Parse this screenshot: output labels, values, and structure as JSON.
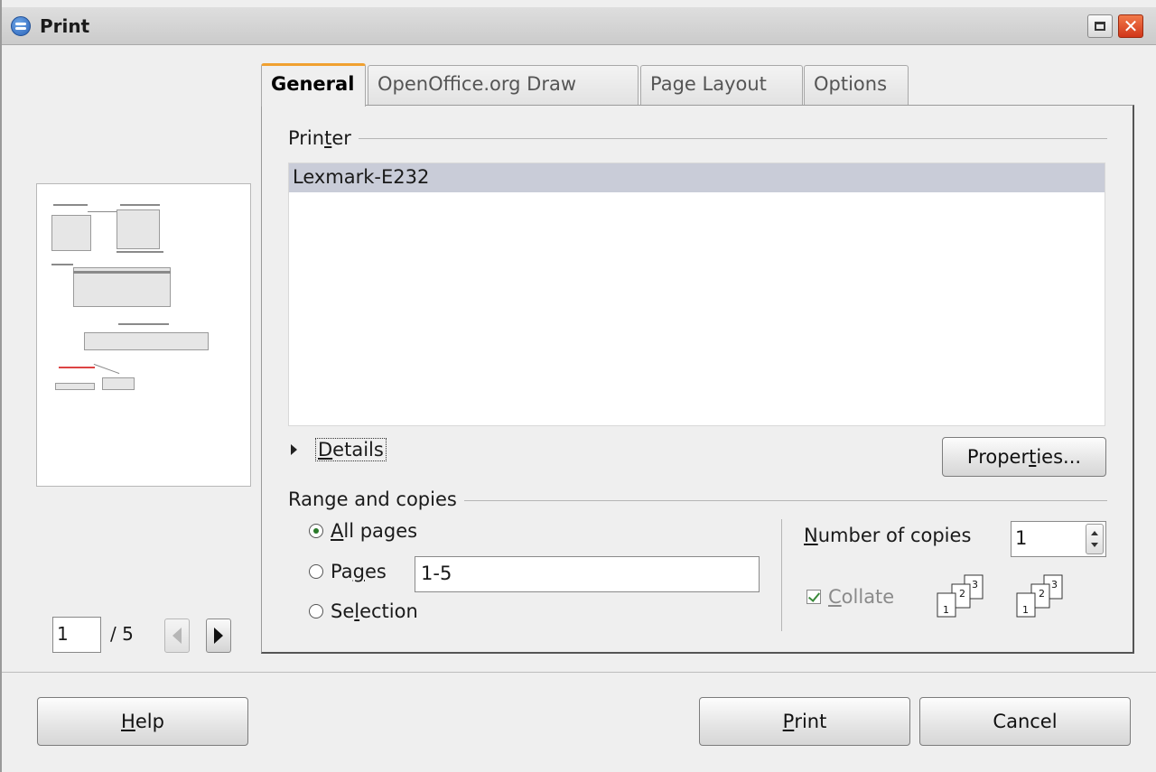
{
  "window": {
    "title": "Print",
    "close_glyph": "✕"
  },
  "tabs": [
    {
      "label": "General",
      "active": true
    },
    {
      "label": "OpenOffice.org Draw",
      "active": false
    },
    {
      "label": "Page Layout",
      "active": false
    },
    {
      "label": "Options",
      "active": false
    }
  ],
  "printer": {
    "group_label_pre": "Prin",
    "group_label_acc": "t",
    "group_label_post": "er",
    "items": [
      "Lexmark-E232"
    ],
    "selected": "Lexmark-E232"
  },
  "details": {
    "label_acc": "D",
    "label_post": "etails"
  },
  "properties_button": {
    "pre": "Proper",
    "acc": "t",
    "post": "ies..."
  },
  "range": {
    "group_label": "Range and copies",
    "all_pages": {
      "pre": "",
      "acc": "A",
      "post": "ll pages",
      "checked": true
    },
    "pages": {
      "pre": "Pa",
      "acc": "g",
      "post": "es",
      "checked": false,
      "value": "1-5"
    },
    "selection": {
      "pre": "Se",
      "acc": "l",
      "post": "ection",
      "checked": false
    }
  },
  "copies": {
    "label_acc": "N",
    "label_post": "umber of copies",
    "value": "1",
    "collate": {
      "acc": "C",
      "post": "ollate",
      "checked": true
    }
  },
  "collate_icons": [
    {
      "numbers": [
        "1",
        "2",
        "3"
      ]
    },
    {
      "numbers": [
        "1",
        "2",
        "3"
      ]
    }
  ],
  "preview": {
    "current_page": "1",
    "total_label": "/ 5"
  },
  "buttons": {
    "help": {
      "acc": "H",
      "post": "elp"
    },
    "print": {
      "acc": "P",
      "post": "rint"
    },
    "cancel": {
      "label": "Cancel"
    }
  },
  "colors": {
    "tab_accent": "#f0a030",
    "selection_bg": "#c9ccd8",
    "close_button": "#d1361a"
  }
}
